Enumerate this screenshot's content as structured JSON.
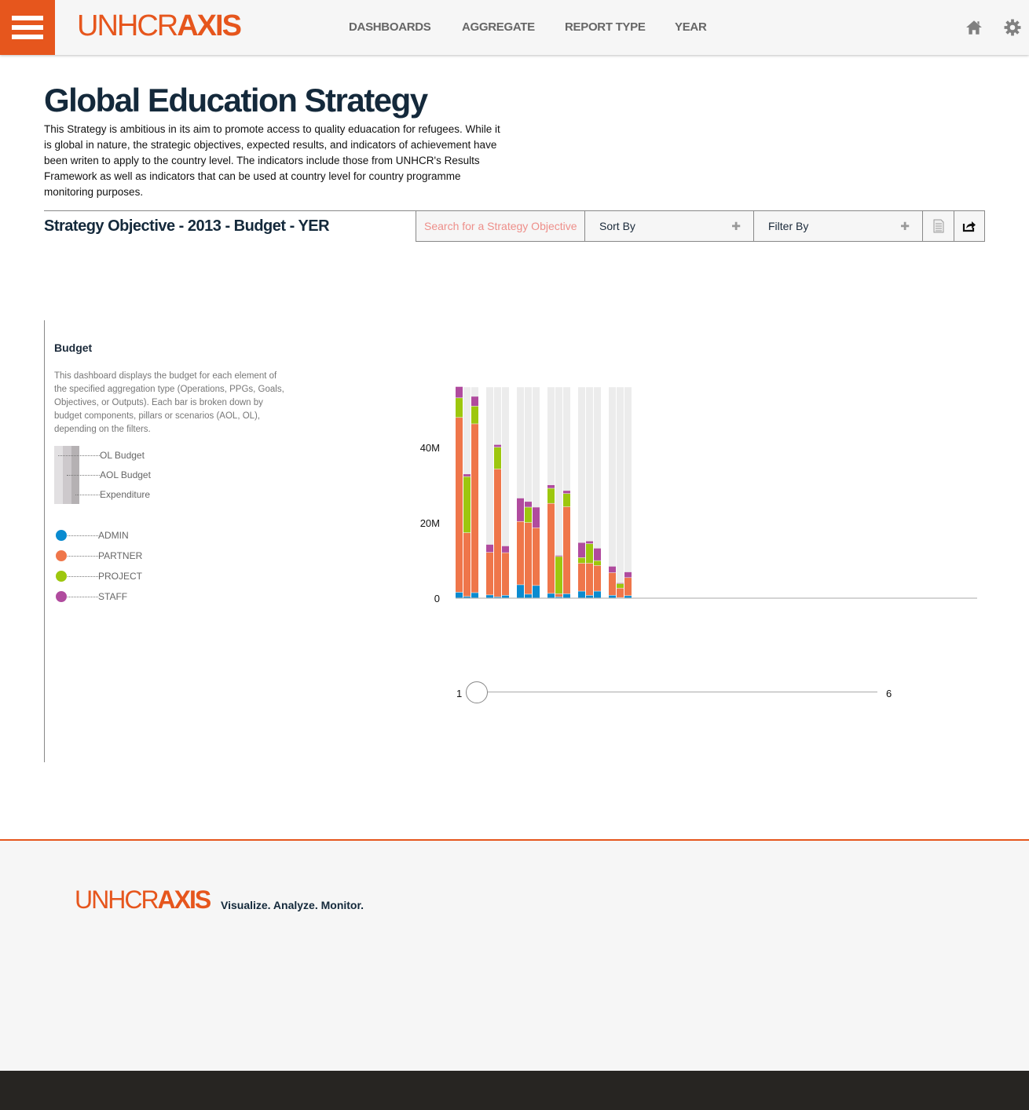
{
  "header": {
    "logo_light": "UNHCR",
    "logo_bold": "AXIS",
    "nav": [
      "DASHBOARDS",
      "AGGREGATE",
      "REPORT TYPE",
      "YEAR"
    ],
    "icons": [
      "menu-icon",
      "home-icon",
      "gear-icon"
    ],
    "brand_color": "#e6561d"
  },
  "page": {
    "title": "Global Education Strategy",
    "intro": "This Strategy is ambitious in its aim to promote access to quality eduacation for refugees. While it is global in nature, the strategic objectives, expected results, and indicators of achievement have been writen to apply to the country level. The indicators include those from UNHCR's Results Framework as well as indicators that can be used at country level for country programme monitoring purposes.",
    "subtitle": "Strategy Objective - 2013 - Budget - YER"
  },
  "toolbar": {
    "search_placeholder": "Search for a Strategy Objective",
    "sort_label": "Sort By",
    "filter_label": "Filter By",
    "icons": [
      "document-icon",
      "share-icon"
    ]
  },
  "panel": {
    "title": "Budget",
    "description": "This dashboard displays the budget for each element of the specified aggregation type (Operations, PPGs, Goals, Objectives, or Outputs). Each bar is broken down by budget components, pillars or scenarios (AOL, OL), depending on the filters.",
    "bar_legend": [
      "OL Budget",
      "AOL Budget",
      "Expenditure"
    ],
    "color_legend": [
      {
        "label": "ADMIN",
        "color": "#0a8bd0"
      },
      {
        "label": "PARTNER",
        "color": "#ef764a"
      },
      {
        "label": "PROJECT",
        "color": "#9dc70e"
      },
      {
        "label": "STAFF",
        "color": "#b04b9e"
      }
    ]
  },
  "chart_data": {
    "type": "bar",
    "stacked": true,
    "yticks": [
      "0",
      "20M",
      "40M"
    ],
    "ylim": [
      0,
      56000000
    ],
    "stack_order": [
      "ADMIN",
      "PARTNER",
      "PROJECT",
      "STAFF"
    ],
    "groups": [
      [
        [
          1.5,
          46.4,
          5.2,
          3.0
        ],
        [
          0.4,
          16.9,
          14.9,
          0.7
        ],
        [
          1.4,
          44.8,
          4.7,
          2.6
        ]
      ],
      [
        [
          0.8,
          11.3,
          0,
          2.1
        ],
        [
          0.3,
          33.9,
          5.8,
          0.7
        ],
        [
          0.7,
          11.3,
          0,
          1.8
        ]
      ],
      [
        [
          3.5,
          16.8,
          0,
          6.2
        ],
        [
          1.0,
          19.0,
          4.1,
          1.5
        ],
        [
          3.3,
          15.3,
          0,
          5.5
        ]
      ],
      [
        [
          1.2,
          23.9,
          4.0,
          0.9
        ],
        [
          0.3,
          0.8,
          9.9,
          0.3
        ],
        [
          1.1,
          23.1,
          3.5,
          0.8
        ]
      ],
      [
        [
          1.8,
          7.4,
          1.5,
          4.0
        ],
        [
          0.7,
          8.5,
          5.2,
          0.7
        ],
        [
          1.8,
          6.8,
          1.3,
          3.3
        ]
      ],
      [
        [
          0.7,
          6.0,
          0,
          1.7
        ],
        [
          0.1,
          2.5,
          1.2,
          0.2
        ],
        [
          0.6,
          4.8,
          0,
          1.5
        ]
      ]
    ],
    "value_unit": "millions",
    "bar_series": [
      "OL Budget",
      "AOL Budget",
      "Expenditure"
    ]
  },
  "slider": {
    "min_label": "1",
    "max_label": "6",
    "value": 1
  },
  "footer": {
    "logo_light": "UNHCR",
    "logo_bold": "AXIS",
    "tagline": "Visualize. Analyze. Monitor."
  }
}
